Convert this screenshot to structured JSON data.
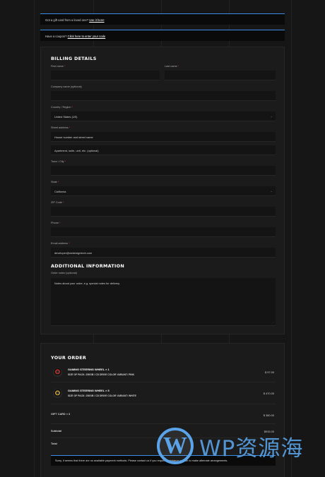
{
  "notices": {
    "gift_text": "Got a gift card from a loved one?",
    "gift_link": "Use it here!",
    "coupon_text": "Have a coupon?",
    "coupon_link": "Click here to enter your code"
  },
  "billing": {
    "heading": "BILLING DETAILS",
    "first_name_label": "First name",
    "last_name_label": "Last name",
    "company_label": "Company name (optional)",
    "country_label": "Country / Region",
    "country_value": "United States (US)",
    "street_label": "Street address",
    "street_placeholder": "House number and street name",
    "apartment_placeholder": "Apartment, suite, unit, etc. (optional)",
    "city_label": "Town / City",
    "state_label": "State",
    "state_value": "California",
    "zip_label": "ZIP Code",
    "phone_label": "Phone",
    "email_label": "Email address",
    "email_value": "developer@wedesigntech.com",
    "required_mark": "*"
  },
  "additional": {
    "heading": "ADDITIONAL INFORMATION",
    "notes_label": "Order notes (optional)",
    "notes_placeholder": "Notes about your order, e.g. special notes for delivery."
  },
  "order": {
    "heading": "YOUR ORDER",
    "items": [
      {
        "name": "GAMING STEERING WHEEL",
        "qty": "× 1",
        "meta": "SIZE OF PACK: 250GB / CD DRIVE COLOR VARIANT: PINK",
        "price": "$ 97.00"
      },
      {
        "name": "GAMING STEERING WHEEL",
        "qty": "× 5",
        "meta": "SIZE OF PACK: 250GB / CD DRIVE COLOR VARIANT: WHITE",
        "price": "$ 470.00"
      }
    ],
    "gift_card": {
      "label": "GIFT CARD",
      "qty": "× 3",
      "price": "$ 360.00"
    },
    "subtotal_label": "Subtotal",
    "subtotal_value": "$915.00",
    "total_label": "Total",
    "payment_message": "Sorry, it seems that there are no available payment methods. Please contact us if you require assistance or wish to make alternate arrangements."
  },
  "watermark": {
    "logo_letter": "W",
    "text": "WP资源海"
  },
  "colors": {
    "accent": "#3a8ee6",
    "required": "#e23b3b",
    "watermark": "#5aa3e8"
  }
}
